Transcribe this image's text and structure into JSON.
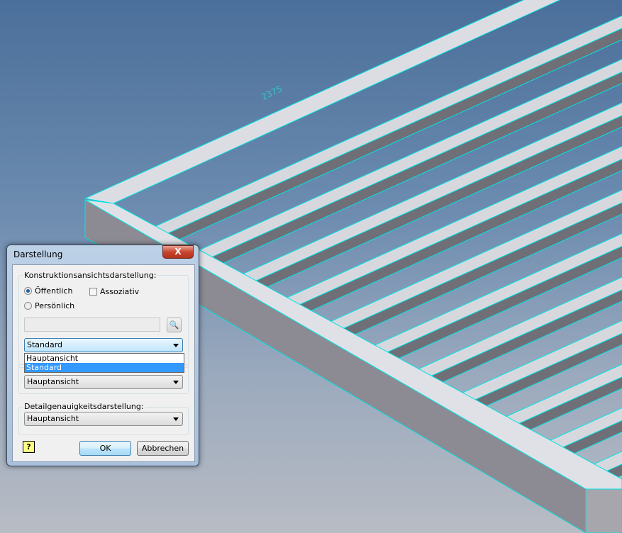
{
  "viewport": {
    "dimension_label": "2375"
  },
  "dialog": {
    "title": "Darstellung",
    "close_label": "X",
    "group1": {
      "label": "Konstruktionsansichtsdarstellung:",
      "radio_public": "Öffentlich",
      "radio_personal": "Persönlich",
      "checkbox_associative": "Assoziativ",
      "name_input_value": "",
      "combo_value": "Standard",
      "dropdown_options": [
        "Hauptansicht",
        "Standard"
      ],
      "selected_option": "Standard"
    },
    "group2": {
      "combo_value": "Hauptansicht"
    },
    "group3": {
      "label": "Detailgenauigkeitsdarstellung:",
      "combo_value": "Hauptansicht"
    },
    "help_label": "?",
    "ok_label": "OK",
    "cancel_label": "Abbrechen"
  },
  "colors": {
    "edge_highlight": "#00e5e5",
    "accent": "#3399ff"
  }
}
